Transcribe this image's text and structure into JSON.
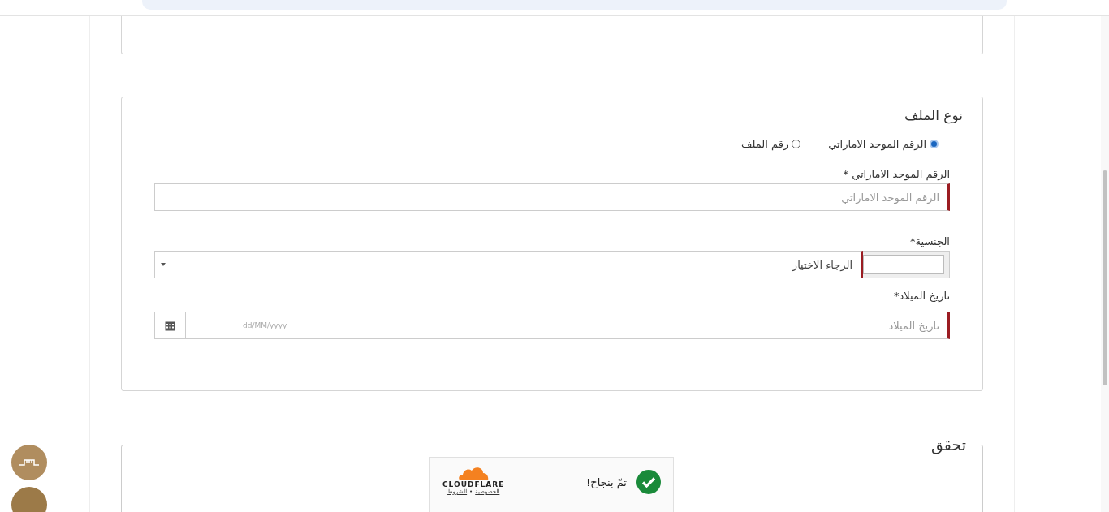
{
  "file_type": {
    "title": "نوع الملف",
    "options": [
      {
        "label": "الرقم الموحد الاماراتي",
        "selected": true
      },
      {
        "label": "رقم الملف",
        "selected": false
      }
    ]
  },
  "fields": [
    {
      "kind": "text",
      "label": "الرقم الموحد الاماراتي *",
      "placeholder": "الرقم الموحد الاماراتي"
    },
    {
      "kind": "select",
      "label": "الجنسية*",
      "value": "الرجاء الاختيار"
    },
    {
      "kind": "date",
      "label": "تاريخ الميلاد*",
      "placeholder": "تاريخ الميلاد",
      "format_hint": "dd/MM/yyyy"
    }
  ],
  "verification": {
    "legend": "تحقق",
    "status": "تمّ بنجاح!",
    "brand": "CLOUDFLARE",
    "links": [
      "الخصوصية",
      "الشروط"
    ],
    "separator": "•"
  }
}
